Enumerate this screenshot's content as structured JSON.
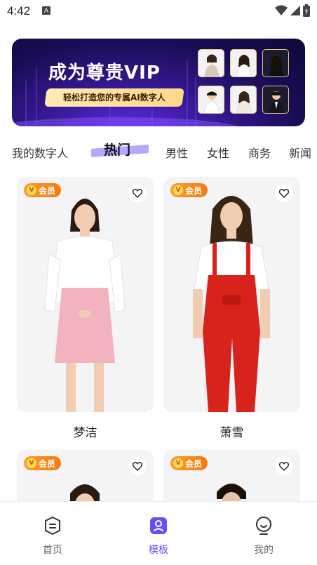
{
  "status_bar": {
    "time": "4:42",
    "notification_glyph": "A",
    "icons": [
      "wifi-icon",
      "signal-icon",
      "battery-icon"
    ]
  },
  "banner": {
    "title": "成为尊贵VIP",
    "subtitle": "轻松打造您的专属AI数字人"
  },
  "tabs": [
    {
      "label": "我的数字人",
      "active": false
    },
    {
      "label": "热门",
      "active": true
    },
    {
      "label": "男性",
      "active": false
    },
    {
      "label": "女性",
      "active": false
    },
    {
      "label": "商务",
      "active": false
    },
    {
      "label": "新闻",
      "active": false
    }
  ],
  "cards": [
    {
      "badge": "会员",
      "badge_v": "V",
      "name": "梦洁"
    },
    {
      "badge": "会员",
      "badge_v": "V",
      "name": "萧雪"
    },
    {
      "badge": "会员",
      "badge_v": "V"
    },
    {
      "badge": "会员",
      "badge_v": "V"
    }
  ],
  "bottom_nav": {
    "items": [
      {
        "label": "首页",
        "icon": "home-icon",
        "active": false
      },
      {
        "label": "模板",
        "icon": "template-icon",
        "active": true
      },
      {
        "label": "我的",
        "icon": "profile-icon",
        "active": false
      }
    ]
  },
  "colors": {
    "accent": "#6c4cf5",
    "vip_badge": "#f57a10",
    "tab_highlight": "#b9a6ff",
    "banner_bg": "#1a0c55"
  }
}
